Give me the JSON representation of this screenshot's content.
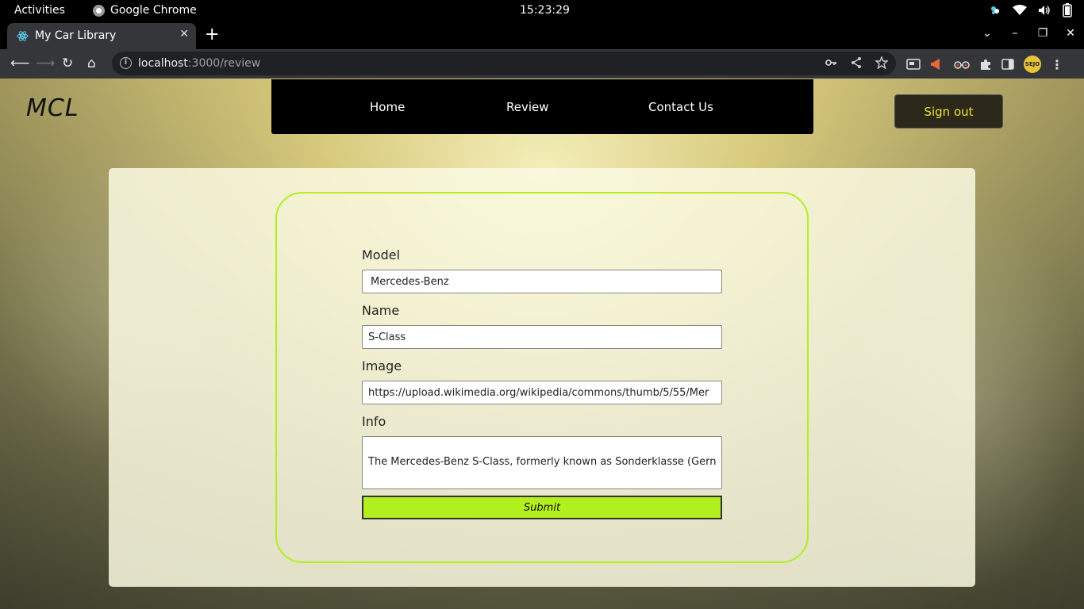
{
  "os": {
    "activities": "Activities",
    "app_name": "Google Chrome",
    "clock": "15:23:29"
  },
  "browser": {
    "tab_title": "My Car Library",
    "url_host": "localhost",
    "url_rest": ":3000/review"
  },
  "site": {
    "logo": "MCL",
    "nav": [
      "Home",
      "Review",
      "Contact Us"
    ],
    "signout_label": "Sign out"
  },
  "form": {
    "model_label": "Model",
    "model_value": "Mercedes-Benz",
    "name_label": "Name",
    "name_value": "S-Class",
    "image_label": "Image",
    "image_value": "https://upload.wikimedia.org/wikipedia/commons/thumb/5/55/Mer",
    "info_label": "Info",
    "info_value": "The Mercedes-Benz S-Class, formerly known as Sonderklasse (Gern",
    "submit_label": "Submit"
  },
  "colors": {
    "accent": "#b2ef1f",
    "signout_text": "#e8e02a"
  }
}
